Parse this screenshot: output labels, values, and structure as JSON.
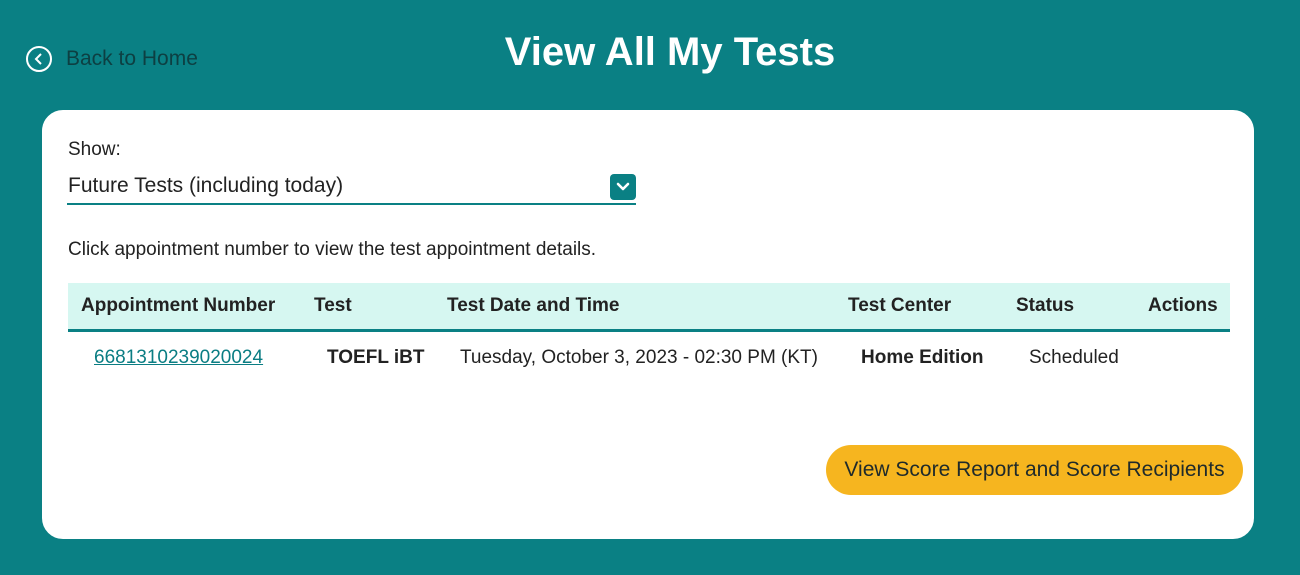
{
  "header": {
    "back_label": "Back to Home",
    "title": "View All My Tests"
  },
  "filter": {
    "label": "Show:",
    "selected": "Future Tests (including today)"
  },
  "hint": "Click appointment number to view the test appointment details.",
  "table": {
    "headers": [
      "Appointment Number",
      "Test",
      "Test Date and Time",
      "Test Center",
      "Status",
      "Actions"
    ],
    "rows": [
      {
        "appointment_number": "6681310239020024",
        "test": "TOEFL iBT",
        "date_time": "Tuesday, October 3, 2023 - 02:30 PM (KT)",
        "test_center": "Home Edition",
        "status": "Scheduled",
        "actions": ""
      }
    ]
  },
  "score_button": "View Score Report and Score Recipients",
  "colors": {
    "brand_teal": "#0a8084",
    "table_header_bg": "#d6f7f1",
    "button_yellow": "#f6b51f"
  },
  "icons": {
    "back": "chevron-left-circle-icon",
    "dropdown": "chevron-down-icon"
  }
}
